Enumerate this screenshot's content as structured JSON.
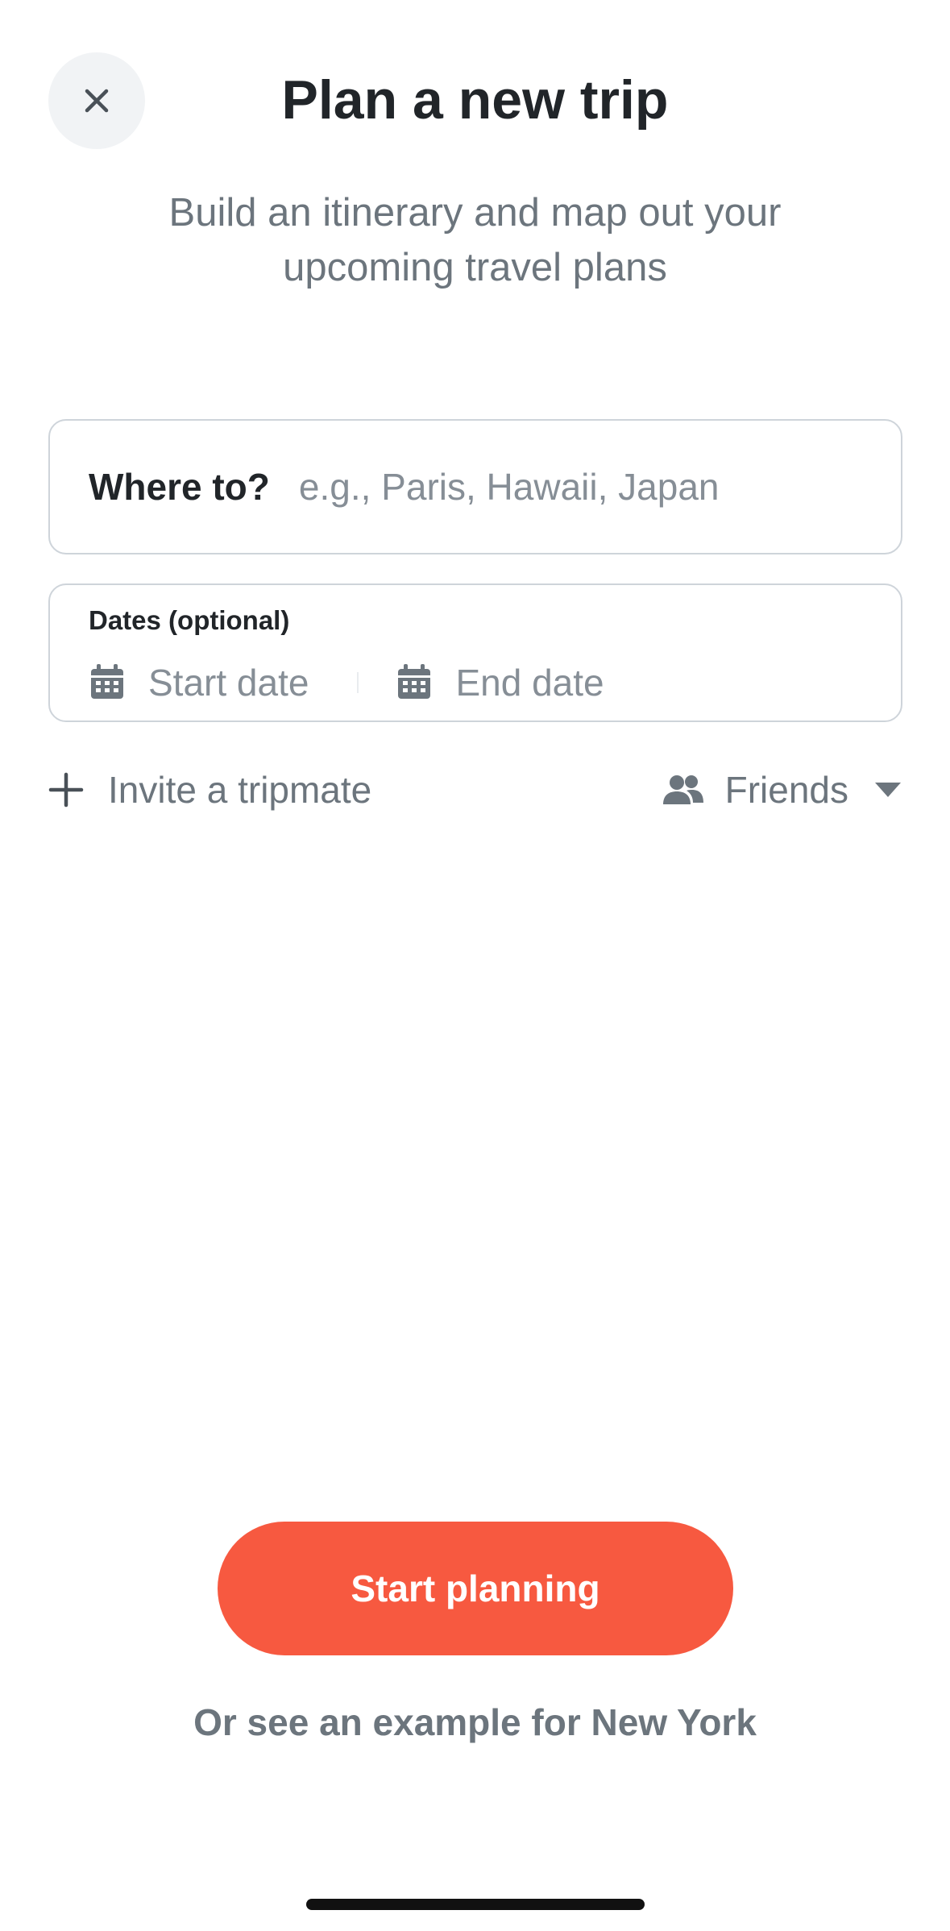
{
  "header": {
    "title": "Plan a new trip",
    "subtitle": "Build an itinerary and map out your upcoming travel plans",
    "close_icon": "close-icon"
  },
  "destination": {
    "label": "Where to?",
    "placeholder": "e.g., Paris, Hawaii, Japan",
    "value": ""
  },
  "dates": {
    "label": "Dates (optional)",
    "start_placeholder": "Start date",
    "end_placeholder": "End date",
    "icon": "calendar-icon"
  },
  "invite": {
    "label": "Invite a tripmate",
    "icon": "plus-icon"
  },
  "privacy": {
    "selected": "Friends",
    "icon": "people-icon",
    "caret_icon": "caret-down-icon"
  },
  "actions": {
    "start_label": "Start planning",
    "example_label": "Or see an example for New York"
  },
  "colors": {
    "accent": "#f75940",
    "text_primary": "#212529",
    "text_secondary": "#6c757d",
    "placeholder": "#868e96",
    "border": "#ced4da",
    "close_bg": "#f1f3f5"
  }
}
